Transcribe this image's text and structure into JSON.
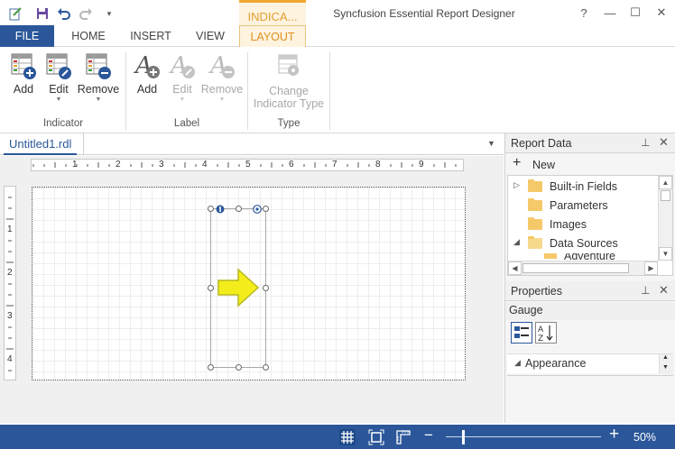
{
  "titlebar": {
    "app_title": "Syncfusion Essential Report Designer",
    "contextual_group": "INDICA...",
    "window_buttons": [
      "?",
      "—",
      "☐",
      "✕"
    ]
  },
  "tabs": [
    "FILE",
    "HOME",
    "INSERT",
    "VIEW",
    "LAYOUT"
  ],
  "ribbon": {
    "indicator": {
      "label": "Indicator",
      "buttons": [
        {
          "label": "Add",
          "icon": "table-add-icon"
        },
        {
          "label": "Edit",
          "icon": "table-edit-icon"
        },
        {
          "label": "Remove",
          "icon": "table-remove-icon"
        }
      ]
    },
    "label_group": {
      "label": "Label",
      "buttons": [
        {
          "label": "Add",
          "icon": "text-add-icon"
        },
        {
          "label": "Edit",
          "icon": "text-edit-icon"
        },
        {
          "label": "Remove",
          "icon": "text-remove-icon"
        }
      ]
    },
    "type_group": {
      "label": "Type",
      "button_line1": "Change",
      "button_line2": "Indicator Type"
    }
  },
  "document": {
    "tab_name": "Untitled1.rdl",
    "ruler_h": [
      "1",
      "2",
      "3",
      "4",
      "5",
      "6",
      "7",
      "8",
      "9"
    ],
    "ruler_v": [
      "1",
      "2",
      "3",
      "4"
    ]
  },
  "report_data": {
    "title": "Report Data",
    "new_label": "New",
    "items": [
      {
        "label": "Built-in Fields",
        "arrow": "▷"
      },
      {
        "label": "Parameters",
        "arrow": ""
      },
      {
        "label": "Images",
        "arrow": ""
      },
      {
        "label": "Data Sources",
        "arrow": "◢"
      },
      {
        "label": "Adventure",
        "arrow": ""
      }
    ]
  },
  "properties": {
    "title": "Properties",
    "object": "Gauge",
    "category": "Appearance"
  },
  "status": {
    "zoom": "50%",
    "minus": "−",
    "plus": "+",
    "zoom_level": 0.5
  }
}
